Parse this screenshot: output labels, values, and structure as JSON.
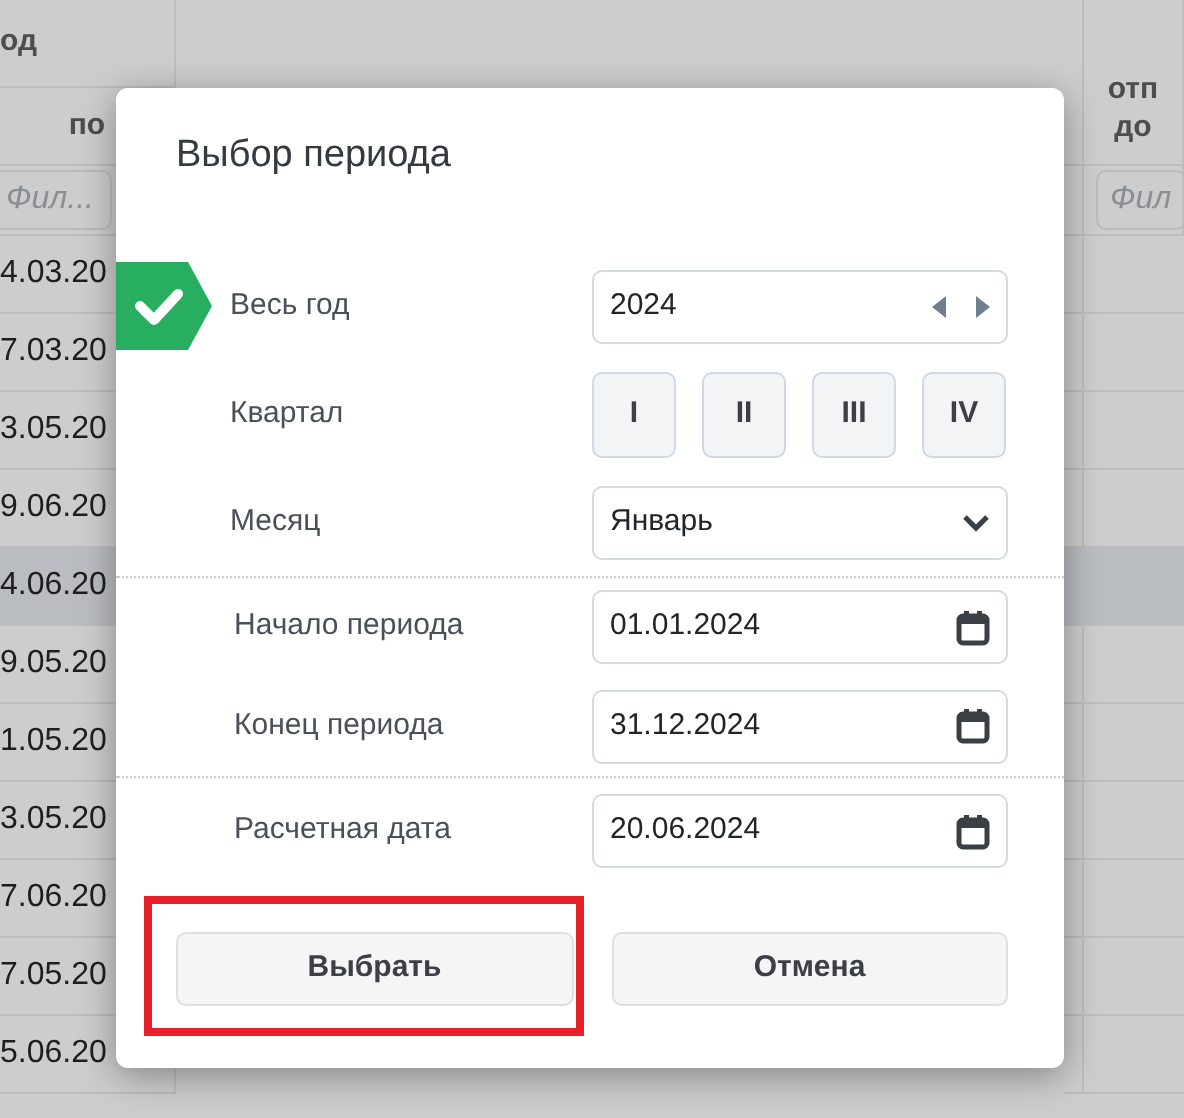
{
  "table": {
    "group_header": "од",
    "columns": [
      {
        "label_lines": [
          "по"
        ],
        "filter_placeholder": "Фил..."
      },
      {
        "label_lines": [
          "отп",
          "до"
        ],
        "filter_placeholder": "Фил"
      }
    ],
    "rows": [
      {
        "column_1": "4.03.20",
        "selected": false
      },
      {
        "column_1": "7.03.20",
        "selected": false
      },
      {
        "column_1": "3.05.20",
        "selected": false
      },
      {
        "column_1": "9.06.20",
        "selected": false
      },
      {
        "column_1": "4.06.20",
        "selected": true
      },
      {
        "column_1": "9.05.20",
        "selected": false
      },
      {
        "column_1": "1.05.20",
        "selected": false
      },
      {
        "column_1": "3.05.20",
        "selected": false
      },
      {
        "column_1": "7.06.20",
        "selected": false
      },
      {
        "column_1": "7.05.20",
        "selected": false
      },
      {
        "column_1": "5.06.20",
        "selected": false
      }
    ]
  },
  "dialog": {
    "title": "Выбор периода",
    "year": {
      "label": "Весь год",
      "checked": true,
      "value": "2024"
    },
    "quarter": {
      "label": "Квартал",
      "options": [
        {
          "label": "I",
          "selected": false
        },
        {
          "label": "II",
          "selected": false
        },
        {
          "label": "III",
          "selected": false
        },
        {
          "label": "IV",
          "selected": false
        }
      ]
    },
    "month": {
      "label": "Месяц",
      "value": "Январь"
    },
    "period_start": {
      "label": "Начало периода",
      "value": "01.01.2024"
    },
    "period_end": {
      "label": "Конец периода",
      "value": "31.12.2024"
    },
    "calc_date": {
      "label": "Расчетная дата",
      "value": "20.06.2024"
    },
    "buttons": [
      {
        "label": "Выбрать",
        "highlighted": true
      },
      {
        "label": "Отмена",
        "highlighted": false
      }
    ]
  }
}
